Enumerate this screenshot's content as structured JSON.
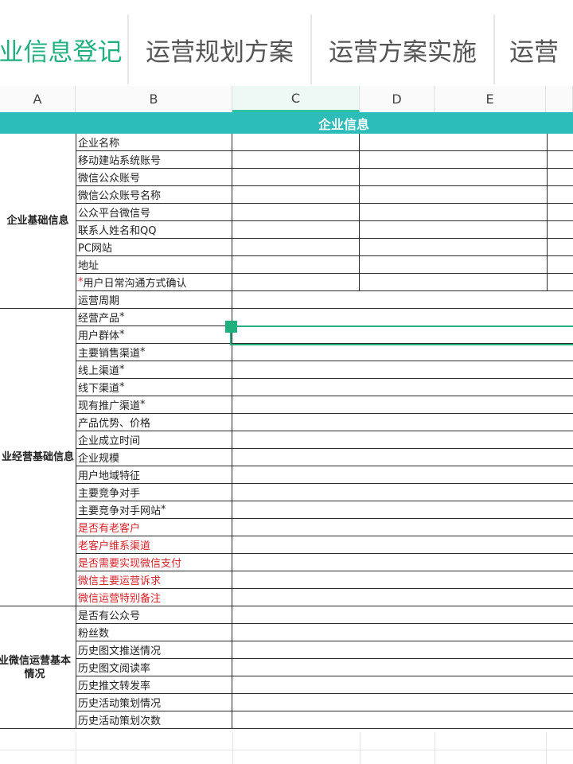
{
  "tabs": [
    {
      "label": "业信息登记",
      "active": true
    },
    {
      "label": "运营规划方案",
      "active": false
    },
    {
      "label": "运营方案实施",
      "active": false
    },
    {
      "label": "运营",
      "active": false
    }
  ],
  "columns": [
    "A",
    "B",
    "C",
    "D",
    "E"
  ],
  "banner": "企业信息",
  "sections": [
    {
      "title": "企业基础信息",
      "rows": [
        {
          "label": "企业名称"
        },
        {
          "label": "移动建站系统账号"
        },
        {
          "label": "微信公众账号"
        },
        {
          "label": "微信公众账号名称"
        },
        {
          "label": "公众平台微信号"
        },
        {
          "label": "联系人姓名和QQ"
        },
        {
          "label": "PC网站"
        },
        {
          "label": "地址"
        },
        {
          "label": "用户日常沟通方式确认",
          "prefix": "*"
        },
        {
          "label": "运营周期"
        }
      ]
    },
    {
      "title": "业经营基础信息",
      "rows": [
        {
          "label": "经营产品",
          "suffix": "*"
        },
        {
          "label": "用户群体",
          "suffix": "*"
        },
        {
          "label": "主要销售渠道",
          "suffix": "*"
        },
        {
          "label": "线上渠道",
          "suffix": "*"
        },
        {
          "label": "线下渠道",
          "suffix": "*"
        },
        {
          "label": "现有推广渠道",
          "suffix": "*"
        },
        {
          "label": "产品优势、价格"
        },
        {
          "label": "企业成立时间"
        },
        {
          "label": "企业规模"
        },
        {
          "label": "用户地域特征"
        },
        {
          "label": "主要竞争对手"
        },
        {
          "label": "主要竞争对手网站",
          "suffix": "*"
        },
        {
          "label": "是否有老客户",
          "red": true
        },
        {
          "label": "老客户维系渠道",
          "red": true
        },
        {
          "label": "是否需要实现微信支付",
          "red": true
        },
        {
          "label": "微信主要运营诉求",
          "red": true
        },
        {
          "label": "微信运营特别备注",
          "red": true
        }
      ]
    },
    {
      "title": "业微信运营基本情况",
      "rows": [
        {
          "label": "是否有公众号"
        },
        {
          "label": "粉丝数"
        },
        {
          "label": "历史图文推送情况"
        },
        {
          "label": "历史图文阅读率"
        },
        {
          "label": "历史推文转发率"
        },
        {
          "label": "历史活动策划情况"
        },
        {
          "label": "历史活动策划次数"
        }
      ]
    }
  ]
}
